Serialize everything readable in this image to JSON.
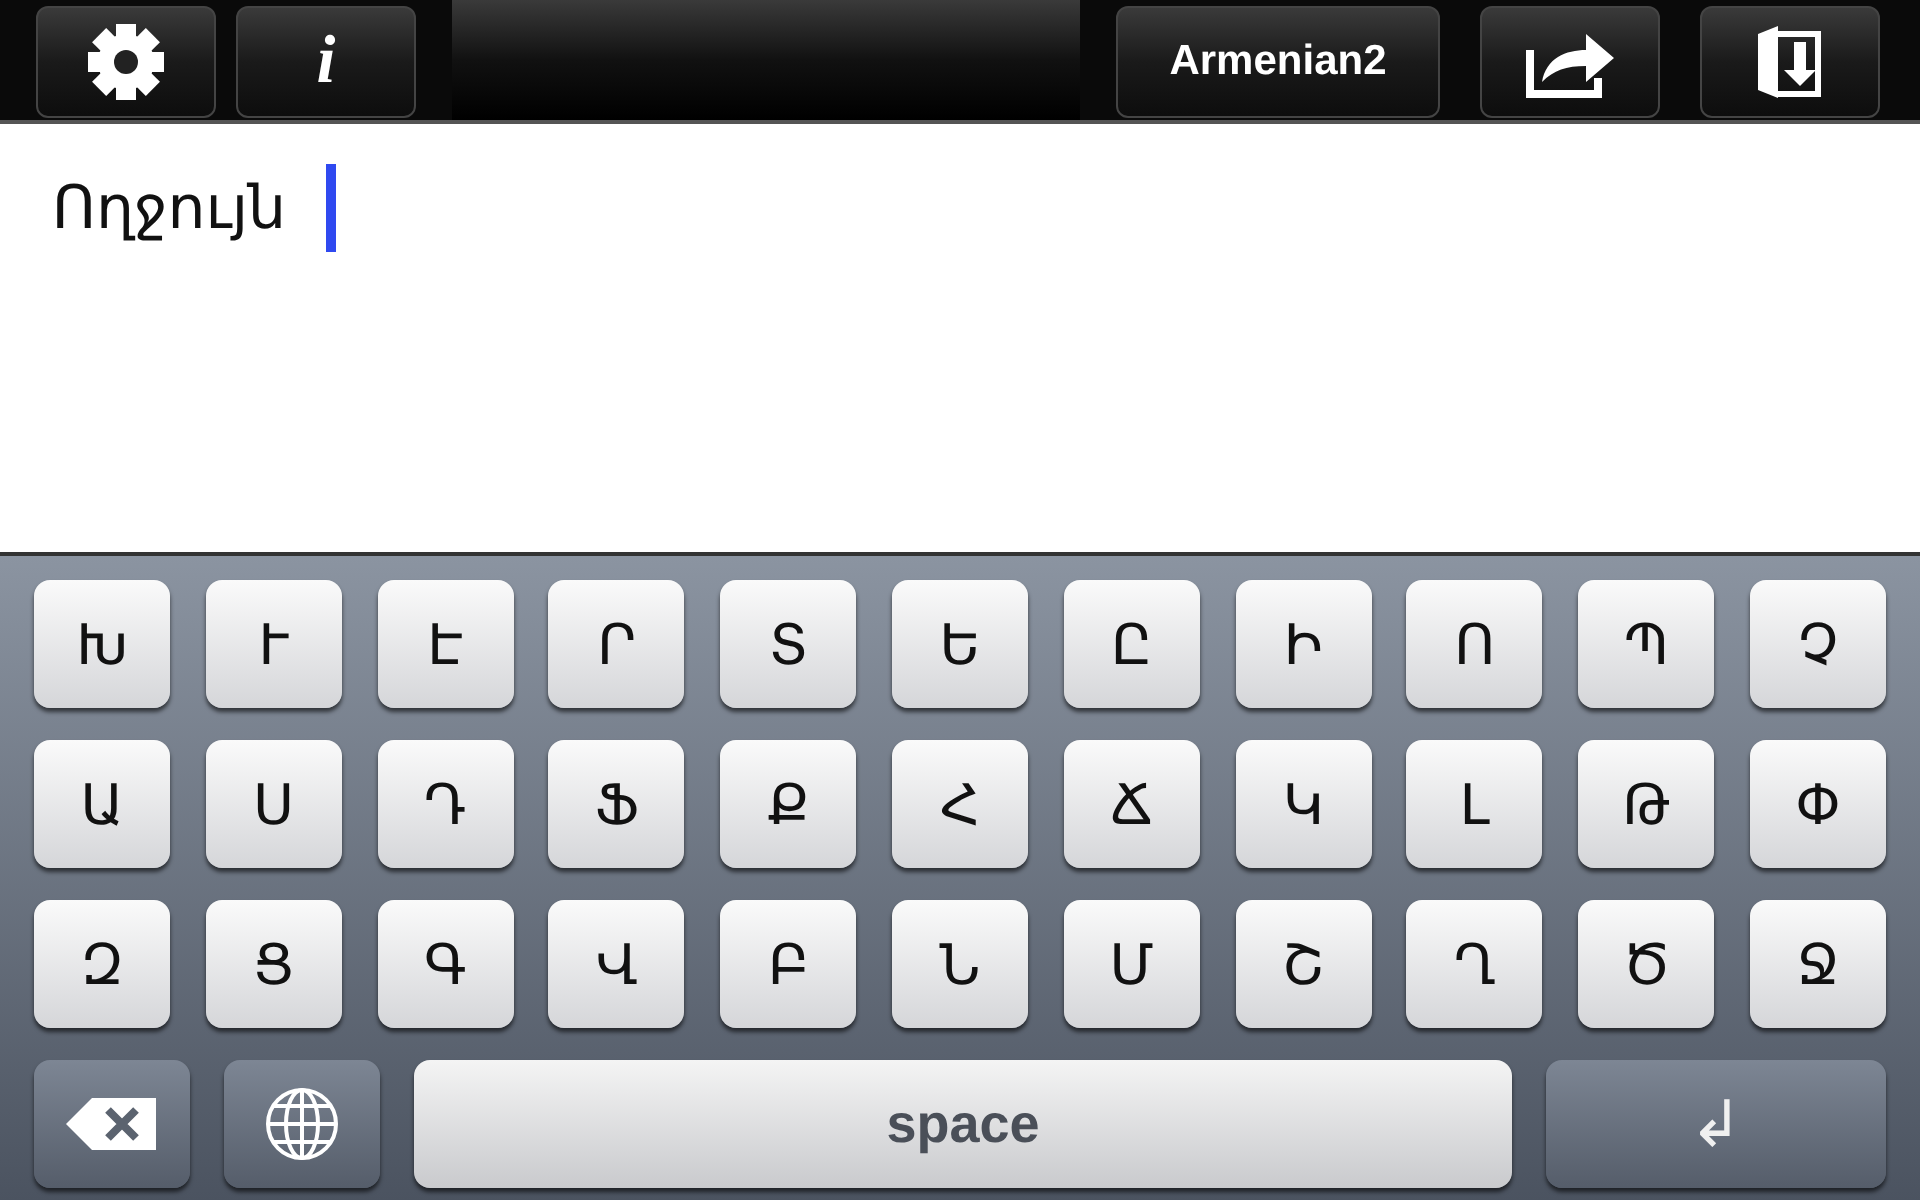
{
  "toolbar": {
    "left_buttons": [
      {
        "kind": "settings"
      },
      {
        "kind": "info",
        "label": "i"
      }
    ],
    "right_buttons": [
      {
        "kind": "text",
        "label": "Armenian2"
      },
      {
        "kind": "share"
      },
      {
        "kind": "save"
      }
    ]
  },
  "editor": {
    "value": "Ողջույն"
  },
  "keyboard": {
    "rows": [
      [
        "Խ",
        "Ւ",
        "Է",
        "Ր",
        "Տ",
        "Ե",
        "Ը",
        "Ի",
        "Ո",
        "Պ",
        "Չ"
      ],
      [
        "Ա",
        "Ս",
        "Դ",
        "Ֆ",
        "Ք",
        "Հ",
        "Ճ",
        "Կ",
        "Լ",
        "Թ",
        "Փ"
      ],
      [
        "Զ",
        "Ց",
        "Գ",
        "Վ",
        "Բ",
        "Ն",
        "Մ",
        "Շ",
        "Ղ",
        "Ծ",
        "Ջ"
      ]
    ],
    "bottom_row": [
      {
        "kind": "delete"
      },
      {
        "kind": "globe"
      },
      {
        "kind": "space",
        "label": "space"
      },
      {
        "kind": "return",
        "label": "↲"
      }
    ]
  }
}
